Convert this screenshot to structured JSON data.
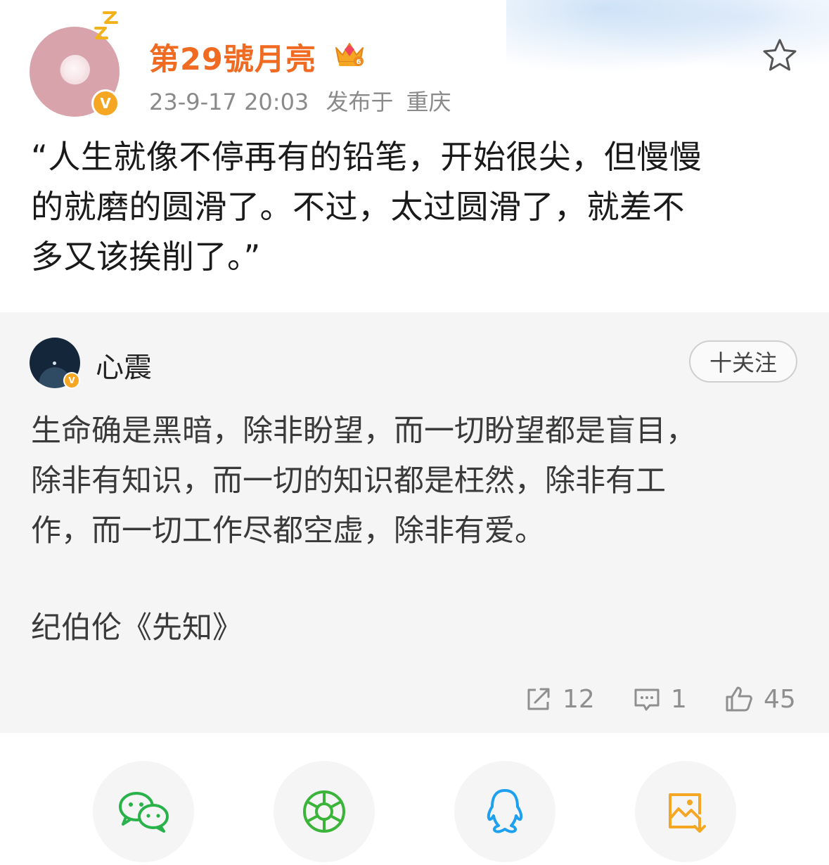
{
  "post": {
    "username": "第29號月亮",
    "timestamp": "23-9-17 20:03",
    "location_prefix": "发布于",
    "location": "重庆",
    "verified_badge": "V",
    "text_lines": [
      "“人生就像不停再有的铅笔，开始很尖，但慢慢",
      "的就磨的圆滑了。不过，太过圆滑了，就差不",
      "多又该挨削了。”"
    ]
  },
  "quoted": {
    "username": "心震",
    "verified_badge": "V",
    "follow_label": "十关注",
    "text_lines": [
      "生命确是黑暗，除非盼望，而一切盼望都是盲目，",
      "除非有知识，而一切的知识都是枉然，除非有工",
      "作，而一切工作尽都空虚，除非有爱。"
    ],
    "source": "纪伯伦《先知》",
    "stats": {
      "reposts": "12",
      "comments": "1",
      "likes": "45"
    }
  },
  "share_targets": [
    {
      "name": "wechat-icon",
      "color": "#29b24a"
    },
    {
      "name": "moments-icon",
      "color": "#3ab53a"
    },
    {
      "name": "qq-icon",
      "color": "#1ea0f0"
    },
    {
      "name": "save-image-icon",
      "color": "#f5a623"
    }
  ],
  "colors": {
    "username": "#f06a22",
    "meta": "#8a8a8a",
    "card_bg": "#f5f5f5"
  }
}
